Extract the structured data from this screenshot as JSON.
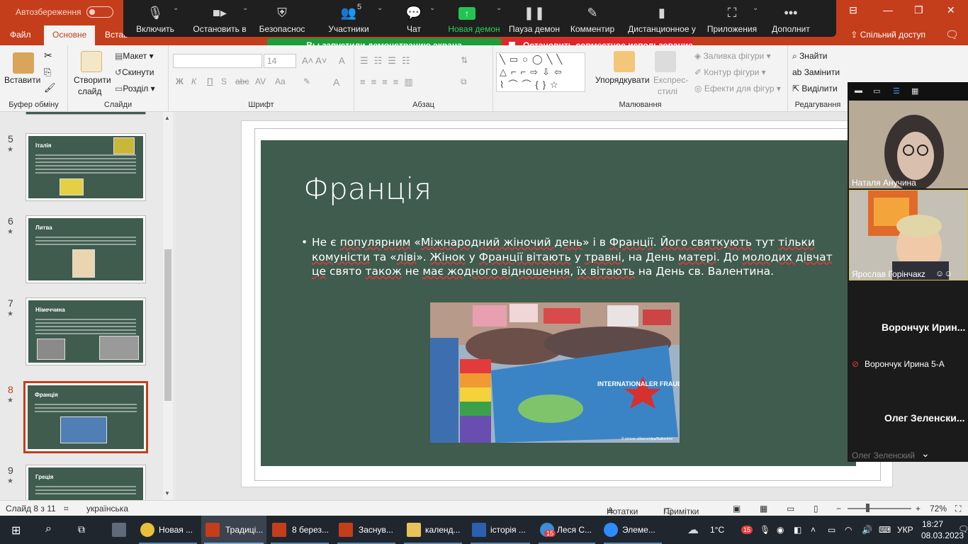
{
  "window": {
    "autosave_label": "Автозбереження",
    "minimize": "—",
    "restore": "❐",
    "close": "✕"
  },
  "zoom_toolbar": {
    "mute": "Включить",
    "video": "Остановить в",
    "security": "Безопаснос",
    "participants": "Участники",
    "participants_count": "5",
    "chat": "Чат",
    "new_share": "Новая демон",
    "pause_share": "Пауза демон",
    "annotate": "Комментир",
    "remote": "Дистанционное у",
    "apps": "Приложения",
    "more": "Дополнит"
  },
  "banners": {
    "sharing": "Вы запустили демонстрацию экрана",
    "stop_sharing": "Остановить совместное использование"
  },
  "tabs": {
    "file": "Файл",
    "home": "Основне",
    "insert": "Встав",
    "share": "Спільний доступ"
  },
  "ribbon": {
    "clipboard": {
      "paste": "Вставити",
      "label": "Буфер обміну"
    },
    "slides": {
      "new_slide": "Створити",
      "new_slide2": "слайд",
      "layout": "Макет",
      "reset": "Скинути",
      "section": "Розділ",
      "label": "Слайди"
    },
    "font": {
      "font_size": "14",
      "bold": "Ж",
      "italic": "К",
      "underline": "П",
      "strike": "abc",
      "spacing": "AV",
      "case": "Aa",
      "label": "Шрифт"
    },
    "paragraph": {
      "label": "Абзац"
    },
    "drawing": {
      "arrange": "Упорядкувати",
      "quick_styles": "Експрес-",
      "quick_styles2": "стилі",
      "fill": "Заливка фігури",
      "outline": "Контур фігури",
      "effects": "Ефекти для фігур",
      "label": "Малювання"
    },
    "editing": {
      "find": "Знайти",
      "replace": "Замінити",
      "select": "Виділити",
      "label": "Редагування"
    }
  },
  "thumbnails": [
    {
      "num": "5",
      "title": "Італія"
    },
    {
      "num": "6",
      "title": "Литва"
    },
    {
      "num": "7",
      "title": "Німеччина"
    },
    {
      "num": "8",
      "title": "Франція"
    },
    {
      "num": "9",
      "title": "Греція"
    }
  ],
  "slide": {
    "title": "Франція",
    "body": [
      "Не є ",
      "популярним",
      " «",
      "Міжнародний жіночий день",
      "» і в ",
      "Франції",
      ". ",
      "Його святкують",
      " тут ",
      "тільки комуністи",
      " та «",
      "ліві",
      "». ",
      "Жінок",
      " у ",
      "Франції вітають",
      " у ",
      "травні",
      ", на День ",
      "матері",
      ". До ",
      "молодих дівчат",
      " ",
      "це",
      " свято ",
      "також",
      " не ",
      "має жодного відношення",
      ", ",
      "їх вітають",
      " на День св. Валентина."
    ],
    "photo_banner": "INTERNATIONALER FRAUEN_KAMPFTAG",
    "photo_credit": "© picture-alliance/dpa/Balkenhol"
  },
  "zoom_panel": {
    "p1": "Наталя Анучина",
    "p2": "Ярослав Горінчакz",
    "p3_big": "Ворончук  Ирин...",
    "p3": "Ворончук Ирина 5-А",
    "p4_big": "Олег  Зеленски...",
    "p4": "Олег Зеленский"
  },
  "statusbar": {
    "slide_info": "Слайд 8 з 11",
    "language": "українська",
    "notes": "Нотатки",
    "comments": "Примітки",
    "zoom": "72%"
  },
  "taskbar": {
    "items": [
      "Новая ...",
      "Традиці...",
      "8 берез...",
      "Заснув...",
      "календ...",
      "історія ...",
      "Леся С...",
      "Элеме..."
    ],
    "weather": "1°C",
    "lang": "УКР",
    "time": "18:27",
    "date": "08.03.2023",
    "badge1": "15",
    "badge2": "15"
  },
  "colors": {
    "ppt_accent": "#c43e1c",
    "slide_bg": "#3f5c4e",
    "zoom_green": "#23c552",
    "zoom_red": "#e0252b"
  }
}
